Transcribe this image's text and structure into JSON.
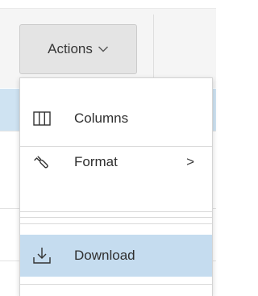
{
  "actions_menu": {
    "button_label": "Actions",
    "items": [
      {
        "label": "Columns",
        "icon": "columns-icon"
      },
      {
        "label": "Format",
        "icon": "wrench-icon",
        "submenu_indicator": ">"
      },
      {
        "label": "Download",
        "icon": "download-icon",
        "highlighted": true
      }
    ]
  },
  "colors": {
    "highlight": "#c5dcef",
    "button_bg": "#e4e4e4",
    "row_highlight": "#cfe3f2"
  }
}
